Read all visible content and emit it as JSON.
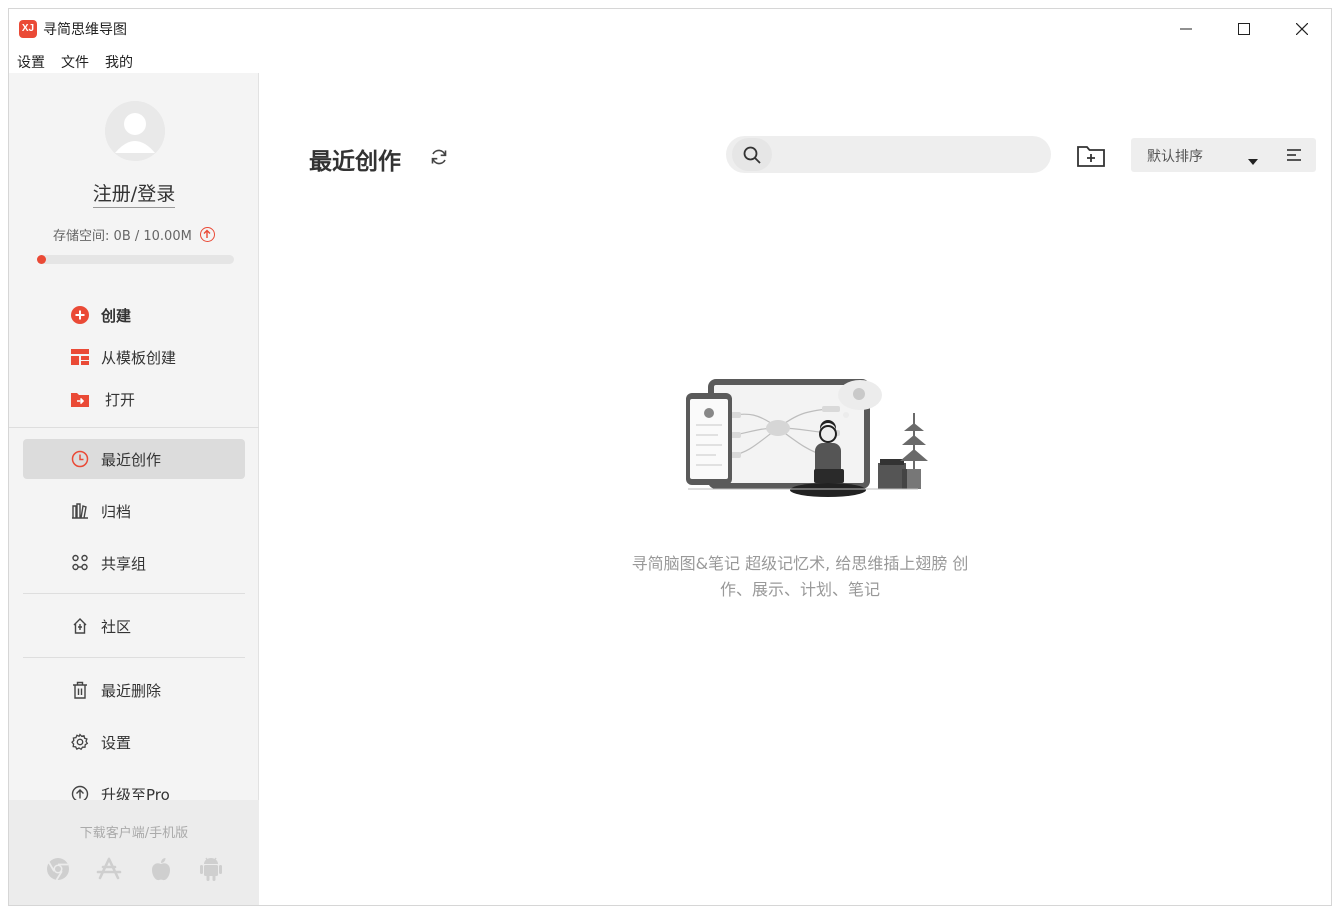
{
  "window": {
    "title": "寻简思维导图",
    "logo_text": "XJ",
    "controls": [
      "minimize-icon",
      "maximize-icon",
      "close-icon"
    ]
  },
  "menubar": {
    "items": [
      {
        "label": "设置"
      },
      {
        "label": "文件"
      },
      {
        "label": "我的"
      }
    ]
  },
  "sidebar": {
    "login_label": "注册/登录",
    "storage_label": "存储空间: 0B / 10.00M",
    "storage_fraction": 0.02,
    "create_items": [
      {
        "label": "创建",
        "icon": "plus-circle-icon"
      },
      {
        "label": "从模板创建",
        "icon": "template-icon"
      },
      {
        "label": "打开",
        "icon": "open-folder-icon"
      }
    ],
    "nav_items": [
      {
        "label": "最近创作",
        "icon": "clock-icon",
        "active": true
      },
      {
        "label": "归档",
        "icon": "archive-icon"
      },
      {
        "label": "共享组",
        "icon": "share-group-icon"
      },
      {
        "label": "社区",
        "icon": "community-icon"
      },
      {
        "label": "最近删除",
        "icon": "trash-icon"
      },
      {
        "label": "设置",
        "icon": "gear-icon"
      },
      {
        "label": "升级至Pro",
        "icon": "upgrade-icon"
      }
    ],
    "download_label": "下载客户端/手机版",
    "download_icons": [
      "chrome-icon",
      "app-store-icon",
      "apple-icon",
      "android-icon"
    ]
  },
  "main": {
    "title": "最近创作",
    "search": {
      "placeholder": "",
      "value": ""
    },
    "sort_label": "默认排序",
    "empty_text_line1": "寻简脑图&笔记 超级记忆术, 给思维插上翅膀 创",
    "empty_text_line2": "作、展示、计划、笔记"
  },
  "colors": {
    "accent": "#ea4a36",
    "sidebar_bg": "#f4f4f4",
    "active_bg": "#dcdcdc",
    "muted_text": "#999999"
  }
}
